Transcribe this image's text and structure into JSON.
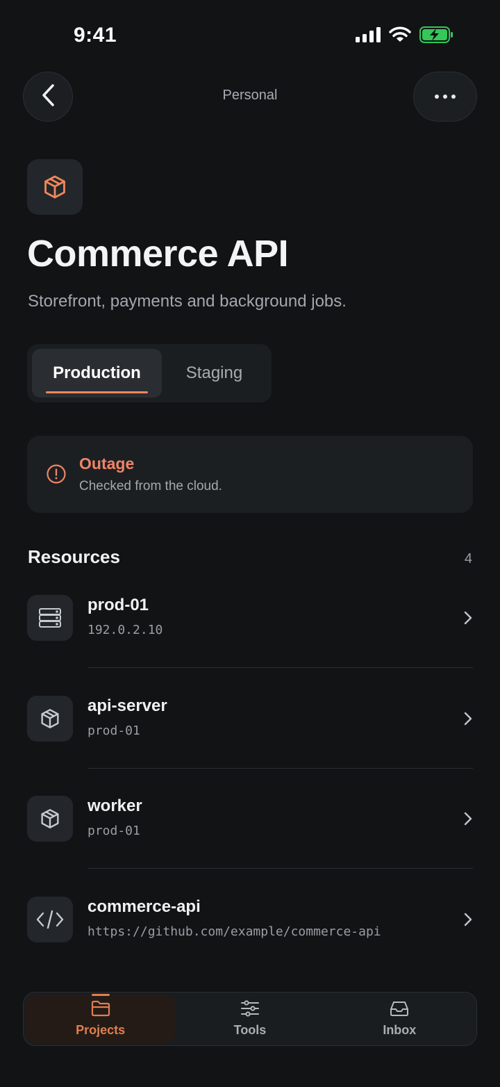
{
  "status_bar": {
    "time": "9:41"
  },
  "nav": {
    "title": "Personal"
  },
  "project": {
    "icon": "package-icon",
    "title": "Commerce API",
    "description": "Storefront, payments and background jobs."
  },
  "environments": {
    "selected": "Production",
    "tabs": [
      {
        "label": "Production"
      },
      {
        "label": "Staging"
      }
    ]
  },
  "alert": {
    "icon": "alert-circle-icon",
    "title": "Outage",
    "subtitle": "Checked from the cloud."
  },
  "resources": {
    "title": "Resources",
    "count": "4",
    "items": [
      {
        "icon": "server-icon",
        "name": "prod-01",
        "subtitle": "192.0.2.10"
      },
      {
        "icon": "package-icon",
        "name": "api-server",
        "subtitle": "prod-01"
      },
      {
        "icon": "package-icon",
        "name": "worker",
        "subtitle": "prod-01"
      },
      {
        "icon": "code-icon",
        "name": "commerce-api",
        "subtitle": "https://github.com/example/commerce-api"
      }
    ]
  },
  "tabbar": {
    "selected": "Projects",
    "items": [
      {
        "icon": "folder-icon",
        "label": "Projects"
      },
      {
        "icon": "sliders-icon",
        "label": "Tools"
      },
      {
        "icon": "inbox-icon",
        "label": "Inbox"
      }
    ]
  },
  "colors": {
    "background": "#111315",
    "accent": "#F0875A",
    "alert": "#F08466",
    "surface": "#1B1F22",
    "battery": "#34C759"
  }
}
